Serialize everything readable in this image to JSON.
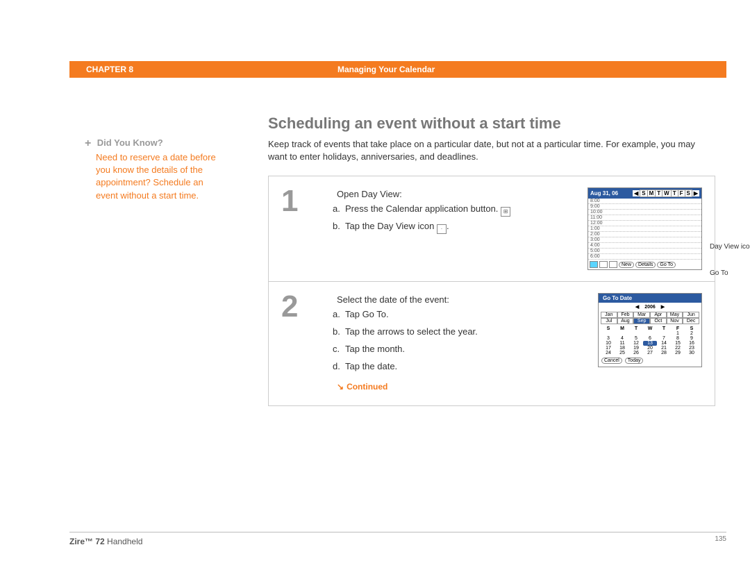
{
  "header": {
    "chapter": "CHAPTER 8",
    "title": "Managing Your Calendar"
  },
  "sidebar": {
    "dyk_title": "Did You Know?",
    "dyk_body": "Need to reserve a date before you know the details of the appointment? Schedule an event without a start time."
  },
  "main": {
    "heading": "Scheduling an event without a start time",
    "intro": "Keep track of events that take place on a particular date, but not at a particular time. For example, you may want to enter holidays, anniversaries, and deadlines."
  },
  "step1": {
    "num": "1",
    "lead": "Open Day View:",
    "a": "Press the Calendar application button.",
    "b": "Tap the Day View icon",
    "callout1": "Day View icon",
    "callout2": "Go To",
    "device": {
      "date": "Aug 31, 06",
      "days": [
        "S",
        "M",
        "T",
        "W",
        "T",
        "F",
        "S"
      ],
      "hours": [
        "8:00",
        "9:00",
        "10:00",
        "11:00",
        "12:00",
        "1:00",
        "2:00",
        "3:00",
        "4:00",
        "5:00",
        "6:00"
      ],
      "btns": {
        "new": "New",
        "details": "Details",
        "goto": "Go To"
      }
    }
  },
  "step2": {
    "num": "2",
    "lead": "Select the date of the event:",
    "a": "Tap Go To.",
    "b": "Tap the arrows to select the year.",
    "c": "Tap the month.",
    "d": "Tap the date.",
    "goto": {
      "title": "Go To Date",
      "year": "2006",
      "months": [
        "Jan",
        "Feb",
        "Mar",
        "Apr",
        "May",
        "Jun",
        "Jul",
        "Aug",
        "Sep",
        "Oct",
        "Nov",
        "Dec"
      ],
      "sel_month": "Sep",
      "dow": [
        "S",
        "M",
        "T",
        "W",
        "T",
        "F",
        "S"
      ],
      "dates": [
        "",
        "",
        "",
        "",
        "",
        "1",
        "2",
        "3",
        "4",
        "5",
        "6",
        "7",
        "8",
        "9",
        "10",
        "11",
        "12",
        "13",
        "14",
        "15",
        "16",
        "17",
        "18",
        "19",
        "20",
        "21",
        "22",
        "23",
        "24",
        "25",
        "26",
        "27",
        "28",
        "29",
        "30"
      ],
      "sel_date": "13",
      "cancel": "Cancel",
      "today": "Today"
    }
  },
  "continued": "Continued",
  "footer": {
    "product_bold": "Zire™ 72",
    "product_rest": " Handheld",
    "page": "135"
  }
}
